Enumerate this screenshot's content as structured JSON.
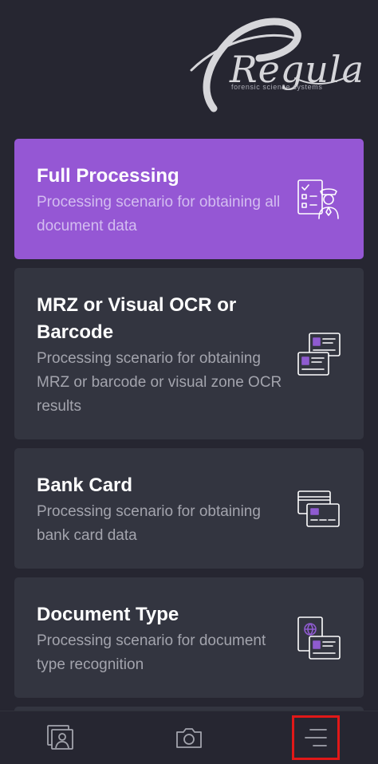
{
  "brand": {
    "logo_text": "Regula",
    "tagline": "forensic science systems"
  },
  "scenarios": [
    {
      "title": "Full Processing",
      "description": "Processing scenario for obtaining all document data",
      "icon": "officer-checklist-icon",
      "selected": true
    },
    {
      "title": "MRZ or Visual OCR or Barcode",
      "description": "Processing scenario for obtaining MRZ or barcode or visual zone OCR results",
      "icon": "id-cards-icon",
      "selected": false
    },
    {
      "title": "Bank Card",
      "description": "Processing scenario for obtaining bank card data",
      "icon": "bank-cards-icon",
      "selected": false
    },
    {
      "title": "Document Type",
      "description": "Processing scenario for document type recognition",
      "icon": "passport-card-icon",
      "selected": false
    }
  ],
  "navbar": {
    "items": [
      {
        "name": "gallery",
        "icon": "gallery-portrait-icon"
      },
      {
        "name": "camera",
        "icon": "camera-icon"
      },
      {
        "name": "menu",
        "icon": "menu-lines-icon",
        "highlighted": true
      }
    ]
  },
  "colors": {
    "background": "#262631",
    "card": "#333540",
    "accent": "#9557d4",
    "icon_accent": "#8f5bd0",
    "highlight": "#e01818"
  }
}
